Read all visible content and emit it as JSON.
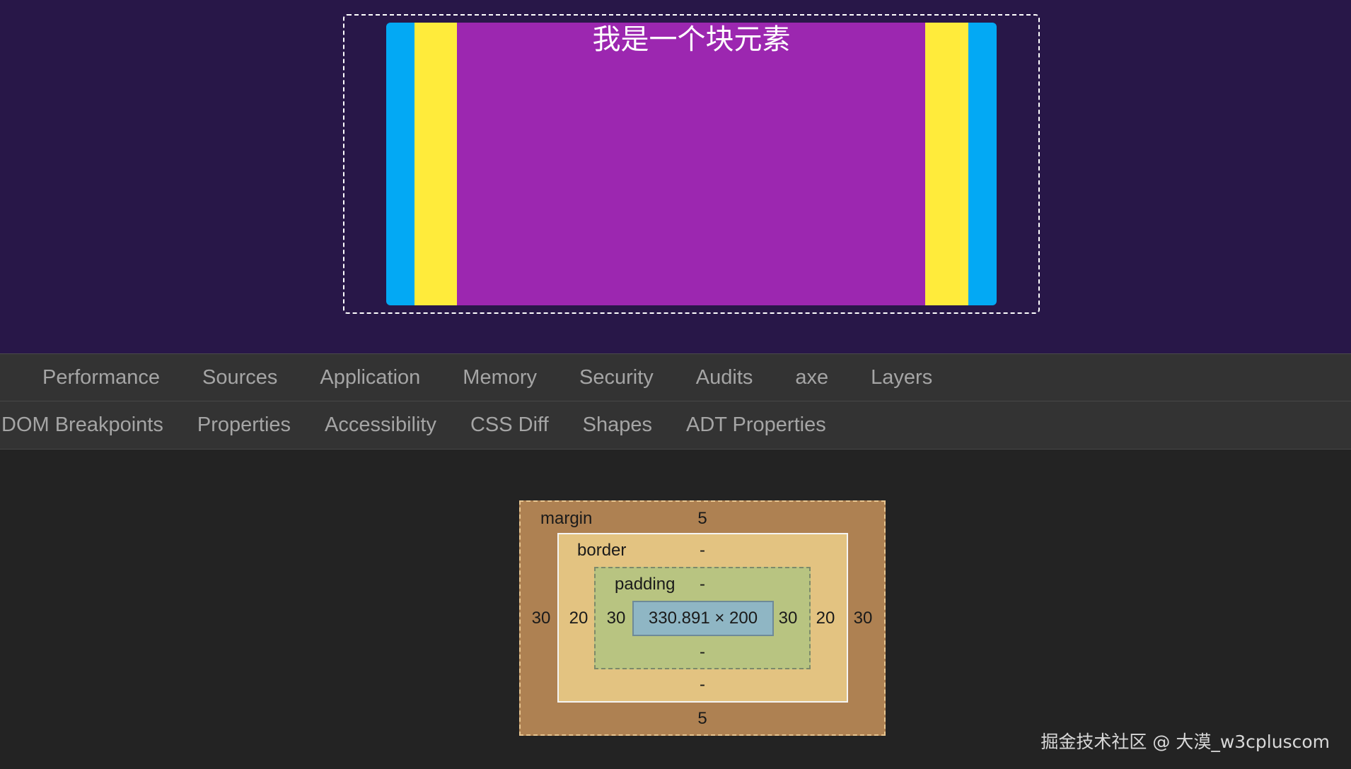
{
  "preview": {
    "block_text": "我是一个块元素",
    "colors": {
      "background": "#281748",
      "outer": "#03a9f4",
      "middle": "#ffeb3b",
      "inner": "#9c27b0",
      "outline": "#ffffff"
    }
  },
  "devtools": {
    "main_tabs": [
      "Performance",
      "Sources",
      "Application",
      "Memory",
      "Security",
      "Audits",
      "axe",
      "Layers"
    ],
    "sub_tabs": [
      "DOM Breakpoints",
      "Properties",
      "Accessibility",
      "CSS Diff",
      "Shapes",
      "ADT Properties"
    ],
    "box_model": {
      "margin_label": "margin",
      "margin_top": "5",
      "margin_bottom": "5",
      "margin_left": "30",
      "margin_right": "30",
      "border_label": "border",
      "border_top": "-",
      "border_bottom": "-",
      "border_left": "20",
      "border_right": "20",
      "padding_label": "padding",
      "padding_top": "-",
      "padding_bottom": "-",
      "padding_left": "30",
      "padding_right": "30",
      "content_size": "330.891 × 200",
      "colors": {
        "margin": "#ae8152",
        "border": "#e3c381",
        "padding": "#b8c481",
        "content": "#8fb6c4"
      }
    }
  },
  "watermark": "掘金技术社区 @ 大漠_w3cpluscom"
}
